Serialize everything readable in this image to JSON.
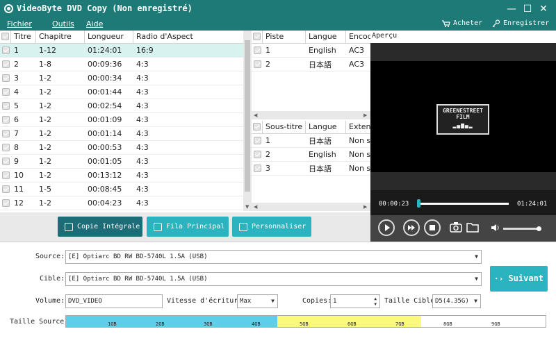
{
  "window": {
    "title": "VideoByte DVD Copy (Non enregistré)",
    "minimize": "—",
    "maximize": "☐",
    "close": "✕"
  },
  "menu": {
    "items": [
      "Fichier",
      "Outils",
      "Aide"
    ],
    "buy": "Acheter",
    "register": "Enregistrer"
  },
  "titles_table": {
    "headers": [
      "Titre",
      "Chapitre",
      "Longueur",
      "Radio d'Aspect"
    ],
    "rows": [
      [
        "1",
        "1-12",
        "01:24:01",
        "16:9"
      ],
      [
        "2",
        "1-8",
        "00:09:36",
        "4:3"
      ],
      [
        "3",
        "1-2",
        "00:00:34",
        "4:3"
      ],
      [
        "4",
        "1-2",
        "00:01:44",
        "4:3"
      ],
      [
        "5",
        "1-2",
        "00:02:54",
        "4:3"
      ],
      [
        "6",
        "1-2",
        "00:01:09",
        "4:3"
      ],
      [
        "7",
        "1-2",
        "00:01:14",
        "4:3"
      ],
      [
        "8",
        "1-2",
        "00:00:53",
        "4:3"
      ],
      [
        "9",
        "1-2",
        "00:01:05",
        "4:3"
      ],
      [
        "10",
        "1-2",
        "00:13:12",
        "4:3"
      ],
      [
        "11",
        "1-5",
        "00:08:45",
        "4:3"
      ],
      [
        "12",
        "1-2",
        "00:04:23",
        "4:3"
      ]
    ]
  },
  "audio_table": {
    "headers": [
      "Piste",
      "Langue",
      "Encode"
    ],
    "rows": [
      [
        "1",
        "English",
        "AC3"
      ],
      [
        "2",
        "日本語",
        "AC3"
      ]
    ]
  },
  "subtitle_table": {
    "headers": [
      "Sous-titre",
      "Langue",
      "Extens"
    ],
    "rows": [
      [
        "1",
        "日本語",
        "Non sp"
      ],
      [
        "2",
        "English",
        "Non sp"
      ],
      [
        "3",
        "日本語",
        "Non sp"
      ]
    ]
  },
  "modes": {
    "full": "Copie Intégrale",
    "main": "Fila Principal",
    "custom": "Personnaliser"
  },
  "preview": {
    "label": "Aperçu",
    "logo_line1": "GREENESTREET",
    "logo_line2": "FILM",
    "current_time": "00:00:23",
    "total_time": "01:24:01",
    "progress": 0.0046,
    "volume": 0.95
  },
  "form": {
    "source_label": "Source:",
    "source_value": "[E] Optiarc BD RW BD-5740L 1.5A (USB)",
    "target_label": "Cible:",
    "target_value": "[E] Optiarc BD RW BD-5740L 1.5A (USB)",
    "volume_label": "Volume:",
    "volume_value": "DVD_VIDEO",
    "speed_label": "Vitesse d'écriture:",
    "speed_value": "Max",
    "copies_label": "Copies:",
    "copies_value": "1",
    "target_size_label": "Taille Cible:",
    "target_size_value": "D5(4.35G)",
    "next_button": "Suivant",
    "source_size_label": "Taille Source:",
    "size_ticks": [
      "1GB",
      "2GB",
      "3GB",
      "4GB",
      "5GB",
      "6GB",
      "7GB",
      "8GB",
      "9GB"
    ],
    "used_gb": 4.4,
    "capacity_gb": 7.4,
    "colors": {
      "used": "#5bd0e8",
      "overflow": "#fafa7a",
      "accent": "#2bb3bf",
      "titlebar": "#1d7a76"
    }
  }
}
